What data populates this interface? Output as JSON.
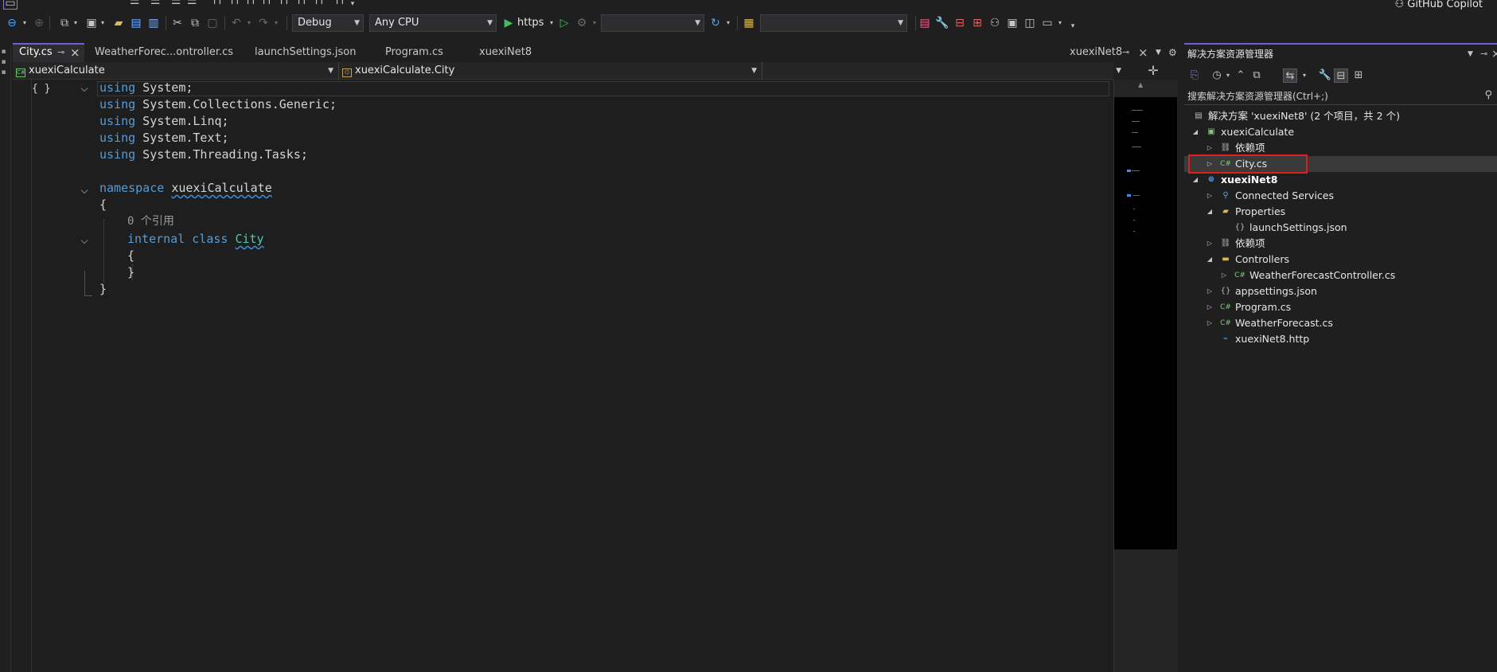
{
  "toolbar": {
    "configuration": "Debug",
    "platform": "Any CPU",
    "run_target": "https",
    "startup_item": "",
    "extra_combo": "",
    "copilot_label": "GitHub Copilot"
  },
  "tabs": [
    {
      "label": "City.cs",
      "active": true,
      "pinned": true
    },
    {
      "label": "WeatherForec...ontroller.cs",
      "active": false
    },
    {
      "label": "launchSettings.json",
      "active": false
    },
    {
      "label": "Program.cs",
      "active": false
    },
    {
      "label": "xuexiNet8",
      "active": false
    }
  ],
  "tabs_overflow_label": "xuexiNet8",
  "navbar": {
    "project": "xuexiCalculate",
    "type": "xuexiCalculate.City",
    "member": ""
  },
  "code": {
    "lines": [
      {
        "kw": "using",
        "rest": " System;"
      },
      {
        "kw": "using",
        "rest": " System.Collections.Generic;"
      },
      {
        "kw": "using",
        "rest": " System.Linq;"
      },
      {
        "kw": "using",
        "rest": " System.Text;"
      },
      {
        "kw": "using",
        "rest": " System.Threading.Tasks;"
      }
    ],
    "namespace_kw": "namespace",
    "namespace_name": "xuexiCalculate",
    "open_brace": "{",
    "refs_hint": "0 个引用",
    "class_mod": "internal",
    "class_kw": "class",
    "class_name": "City",
    "class_open": "{",
    "class_close": "}",
    "ns_close": "}"
  },
  "explorer": {
    "title": "解决方案资源管理器",
    "search_placeholder": "搜索解决方案资源管理器(Ctrl+;)",
    "nodes": [
      {
        "label": "解决方案 'xuexiNet8' (2 个项目，共 2 个)",
        "icon": "solution-icon"
      },
      {
        "label": "xuexiCalculate",
        "icon": "csharp-project-icon"
      },
      {
        "label": "依赖项",
        "icon": "dependencies-icon"
      },
      {
        "label": "City.cs",
        "icon": "csharp-file-icon"
      },
      {
        "label": "xuexiNet8",
        "icon": "web-project-icon"
      },
      {
        "label": "Connected Services",
        "icon": "connected-services-icon"
      },
      {
        "label": "Properties",
        "icon": "properties-folder-icon"
      },
      {
        "label": "launchSettings.json",
        "icon": "json-file-icon"
      },
      {
        "label": "依赖项",
        "icon": "dependencies-icon"
      },
      {
        "label": "Controllers",
        "icon": "folder-icon"
      },
      {
        "label": "WeatherForecastController.cs",
        "icon": "csharp-file-icon"
      },
      {
        "label": "appsettings.json",
        "icon": "json-file-icon"
      },
      {
        "label": "Program.cs",
        "icon": "csharp-file-icon"
      },
      {
        "label": "WeatherForecast.cs",
        "icon": "csharp-file-icon"
      },
      {
        "label": "xuexiNet8.http",
        "icon": "http-file-icon"
      }
    ]
  },
  "colors": {
    "accent": "#6e5bd8",
    "keyword": "#569cd6",
    "type": "#4ec9b0",
    "highlight": "#e01e1e"
  }
}
